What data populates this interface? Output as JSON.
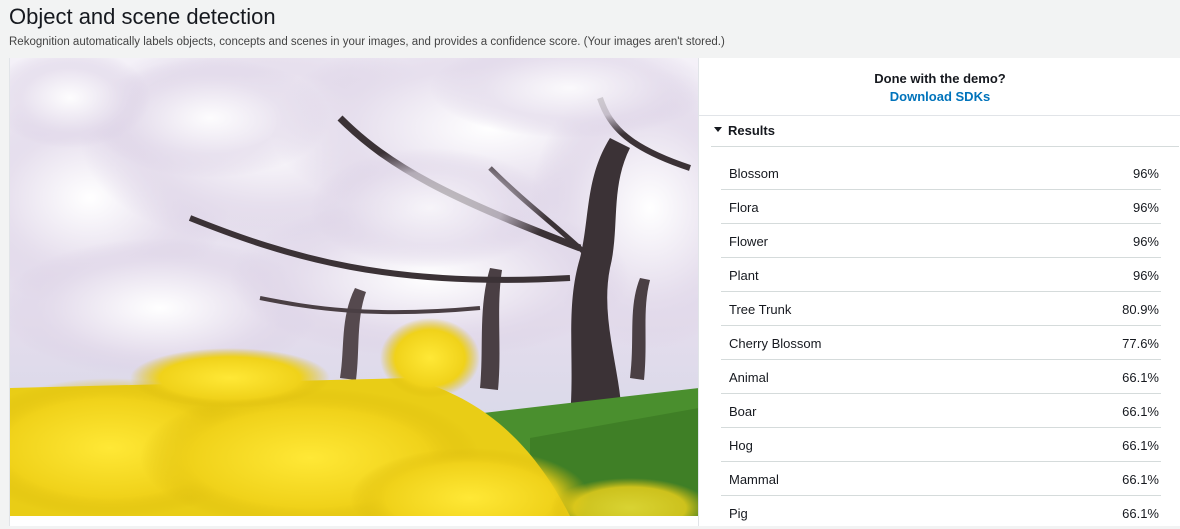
{
  "page": {
    "title": "Object and scene detection",
    "subtitle": "Rekognition automatically labels objects, concepts and scenes in your images, and provides a confidence score. (Your images aren't stored.)"
  },
  "demo": {
    "prompt": "Done with the demo?",
    "link_label": "Download SDKs"
  },
  "results": {
    "header": "Results",
    "expanded": true,
    "items": [
      {
        "label": "Blossom",
        "score": "96%"
      },
      {
        "label": "Flora",
        "score": "96%"
      },
      {
        "label": "Flower",
        "score": "96%"
      },
      {
        "label": "Plant",
        "score": "96%"
      },
      {
        "label": "Tree Trunk",
        "score": "80.9%"
      },
      {
        "label": "Cherry Blossom",
        "score": "77.6%"
      },
      {
        "label": "Animal",
        "score": "66.1%"
      },
      {
        "label": "Boar",
        "score": "66.1%"
      },
      {
        "label": "Hog",
        "score": "66.1%"
      },
      {
        "label": "Mammal",
        "score": "66.1%"
      },
      {
        "label": "Pig",
        "score": "66.1%"
      }
    ]
  },
  "colors": {
    "link": "#0073bb",
    "blossom": "#ece6f2",
    "rapeseed": "#f2d81a",
    "grass": "#4a8f2e"
  }
}
